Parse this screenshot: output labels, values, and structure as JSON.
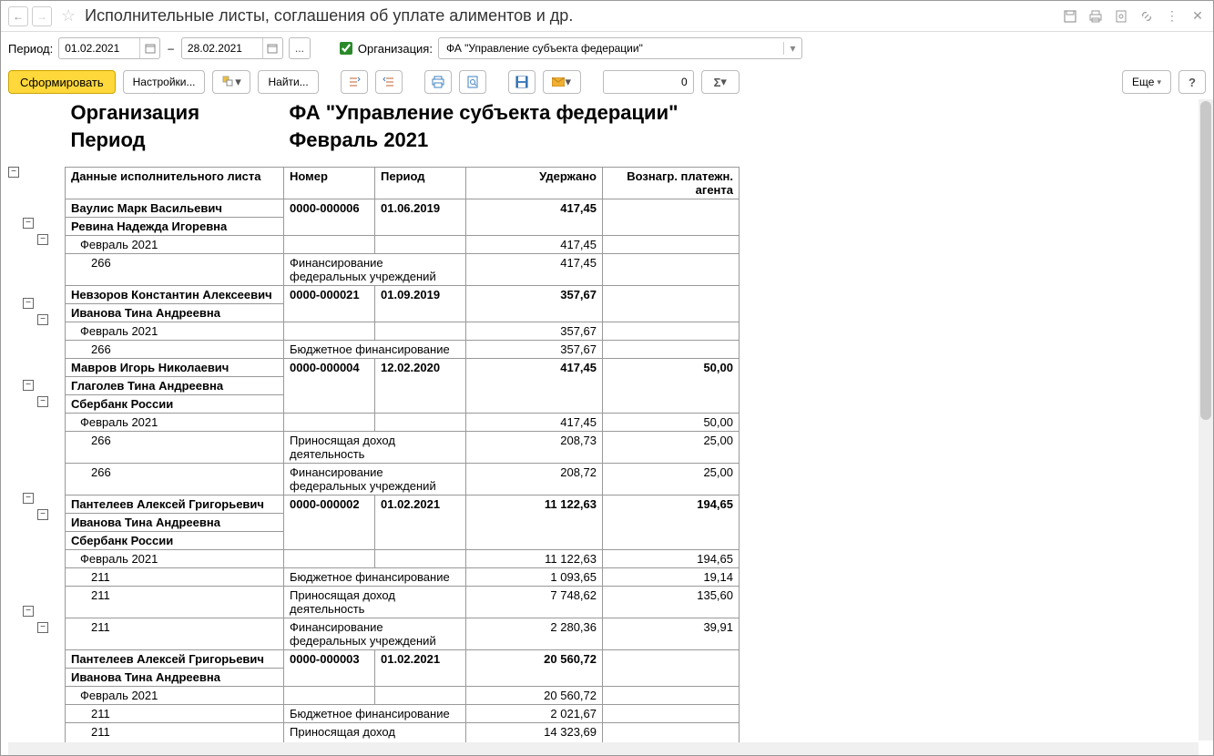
{
  "title": "Исполнительные листы, соглашения об уплате алиментов и др.",
  "filter": {
    "period_label": "Период:",
    "date_from": "01.02.2021",
    "date_to": "28.02.2021",
    "dash": "–",
    "ellipsis": "...",
    "org_label": "Организация:",
    "org_value": "ФА \"Управление субъекта федерации\""
  },
  "toolbar": {
    "form": "Сформировать",
    "settings": "Настройки...",
    "find": "Найти...",
    "number_value": "0",
    "more": "Еще",
    "help": "?"
  },
  "report_header": {
    "org_label": "Организация",
    "org_value": "ФА \"Управление субъекта федерации\"",
    "period_label": "Период",
    "period_value": "Февраль 2021"
  },
  "columns": {
    "c1": "Данные исполнительного листа",
    "c2": "Номер",
    "c3": "Период",
    "c4": "Удержано",
    "c5": "Вознагр. платежн. агента"
  },
  "rows": [
    {
      "type": "group",
      "lines": [
        "Ваулис Марк Васильевич",
        "Ревина Надежда Игоревна"
      ],
      "num": "0000-000006",
      "period": "01.06.2019",
      "amt": "417,45",
      "agent": ""
    },
    {
      "type": "sub1",
      "label": "Февраль 2021",
      "amt": "417,45",
      "agent": ""
    },
    {
      "type": "sub2",
      "code": "266",
      "desc": "Финансирование федеральных учреждений",
      "amt": "417,45",
      "agent": ""
    },
    {
      "type": "group",
      "lines": [
        "Невзоров Константин Алексеевич",
        "Иванова Тина Андреевна"
      ],
      "num": "0000-000021",
      "period": "01.09.2019",
      "amt": "357,67",
      "agent": ""
    },
    {
      "type": "sub1",
      "label": "Февраль 2021",
      "amt": "357,67",
      "agent": ""
    },
    {
      "type": "sub2",
      "code": "266",
      "desc": "Бюджетное финансирование",
      "amt": "357,67",
      "agent": ""
    },
    {
      "type": "group",
      "lines": [
        "Мавров Игорь Николаевич",
        "Глаголев Тина Андреевна",
        "Сбербанк России"
      ],
      "num": "0000-000004",
      "period": "12.02.2020",
      "amt": "417,45",
      "agent": "50,00"
    },
    {
      "type": "sub1",
      "label": "Февраль 2021",
      "amt": "417,45",
      "agent": "50,00"
    },
    {
      "type": "sub2",
      "code": "266",
      "desc": "Приносящая доход деятельность",
      "amt": "208,73",
      "agent": "25,00"
    },
    {
      "type": "sub2",
      "code": "266",
      "desc": "Финансирование федеральных учреждений",
      "amt": "208,72",
      "agent": "25,00"
    },
    {
      "type": "group",
      "lines": [
        "Пантелеев Алексей Григорьевич",
        "Иванова Тина Андреевна",
        "Сбербанк России"
      ],
      "num": "0000-000002",
      "period": "01.02.2021",
      "amt": "11 122,63",
      "agent": "194,65"
    },
    {
      "type": "sub1",
      "label": "Февраль 2021",
      "amt": "11 122,63",
      "agent": "194,65"
    },
    {
      "type": "sub2",
      "code": "211",
      "desc": "Бюджетное финансирование",
      "amt": "1 093,65",
      "agent": "19,14"
    },
    {
      "type": "sub2",
      "code": "211",
      "desc": "Приносящая доход деятельность",
      "amt": "7 748,62",
      "agent": "135,60"
    },
    {
      "type": "sub2",
      "code": "211",
      "desc": "Финансирование федеральных учреждений",
      "amt": "2 280,36",
      "agent": "39,91"
    },
    {
      "type": "group",
      "lines": [
        "Пантелеев Алексей Григорьевич",
        "Иванова Тина Андреевна"
      ],
      "num": "0000-000003",
      "period": "01.02.2021",
      "amt": "20 560,72",
      "agent": ""
    },
    {
      "type": "sub1",
      "label": "Февраль 2021",
      "amt": "20 560,72",
      "agent": ""
    },
    {
      "type": "sub2",
      "code": "211",
      "desc": "Бюджетное финансирование",
      "amt": "2 021,67",
      "agent": ""
    },
    {
      "type": "sub2",
      "code": "211",
      "desc": "Приносящая доход деятельность",
      "amt": "14 323,69",
      "agent": ""
    }
  ]
}
